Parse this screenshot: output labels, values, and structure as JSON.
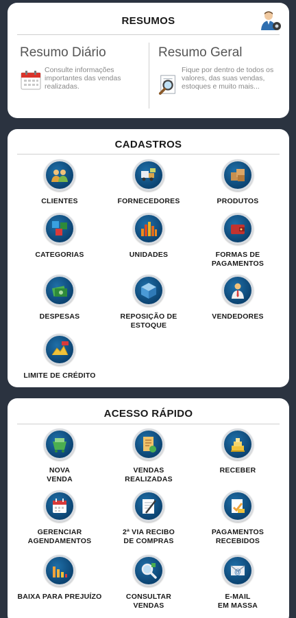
{
  "resumos": {
    "header": "RESUMOS",
    "daily": {
      "title": "Resumo Diário",
      "text": "Consulte informações importantes das vendas realizadas."
    },
    "general": {
      "title": "Resumo Geral",
      "text": "Fique por dentro de todos os valores, das suas vendas, estoques e muito mais..."
    }
  },
  "cadastros": {
    "header": "CADASTROS",
    "items": [
      {
        "label": "CLIENTES",
        "icon": "customers-icon"
      },
      {
        "label": "FORNECEDORES",
        "icon": "suppliers-icon"
      },
      {
        "label": "PRODUTOS",
        "icon": "products-icon"
      },
      {
        "label": "CATEGORIAS",
        "icon": "categories-icon"
      },
      {
        "label": "UNIDADES",
        "icon": "units-icon"
      },
      {
        "label": "FORMAS DE\nPAGAMENTOS",
        "icon": "wallet-icon"
      },
      {
        "label": "DESPESAS",
        "icon": "expenses-icon"
      },
      {
        "label": "REPOSIÇÃO DE\nESTOQUE",
        "icon": "restock-icon"
      },
      {
        "label": "VENDEDORES",
        "icon": "sellers-icon"
      },
      {
        "label": "LIMITE DE CRÉDITO",
        "icon": "credit-limit-icon"
      }
    ]
  },
  "acesso": {
    "header": "ACESSO RÁPIDO",
    "items": [
      {
        "label": "NOVA\nVENDA",
        "icon": "new-sale-icon"
      },
      {
        "label": "VENDAS\nREALIZADAS",
        "icon": "sales-done-icon"
      },
      {
        "label": "RECEBER",
        "icon": "receive-icon"
      },
      {
        "label": "GERENCIAR\nAGENDAMENTOS",
        "icon": "calendar-icon"
      },
      {
        "label": "2ª VIA RECIBO\nDE COMPRAS",
        "icon": "receipt-icon"
      },
      {
        "label": "PAGAMENTOS\nRECEBIDOS",
        "icon": "payments-received-icon"
      },
      {
        "label": "BAIXA PARA PREJUÍZO",
        "icon": "loss-icon"
      },
      {
        "label": "CONSULTAR\nVENDAS",
        "icon": "search-sales-icon"
      },
      {
        "label": "E-MAIL\nEM MASSA",
        "icon": "mass-email-icon"
      }
    ]
  }
}
